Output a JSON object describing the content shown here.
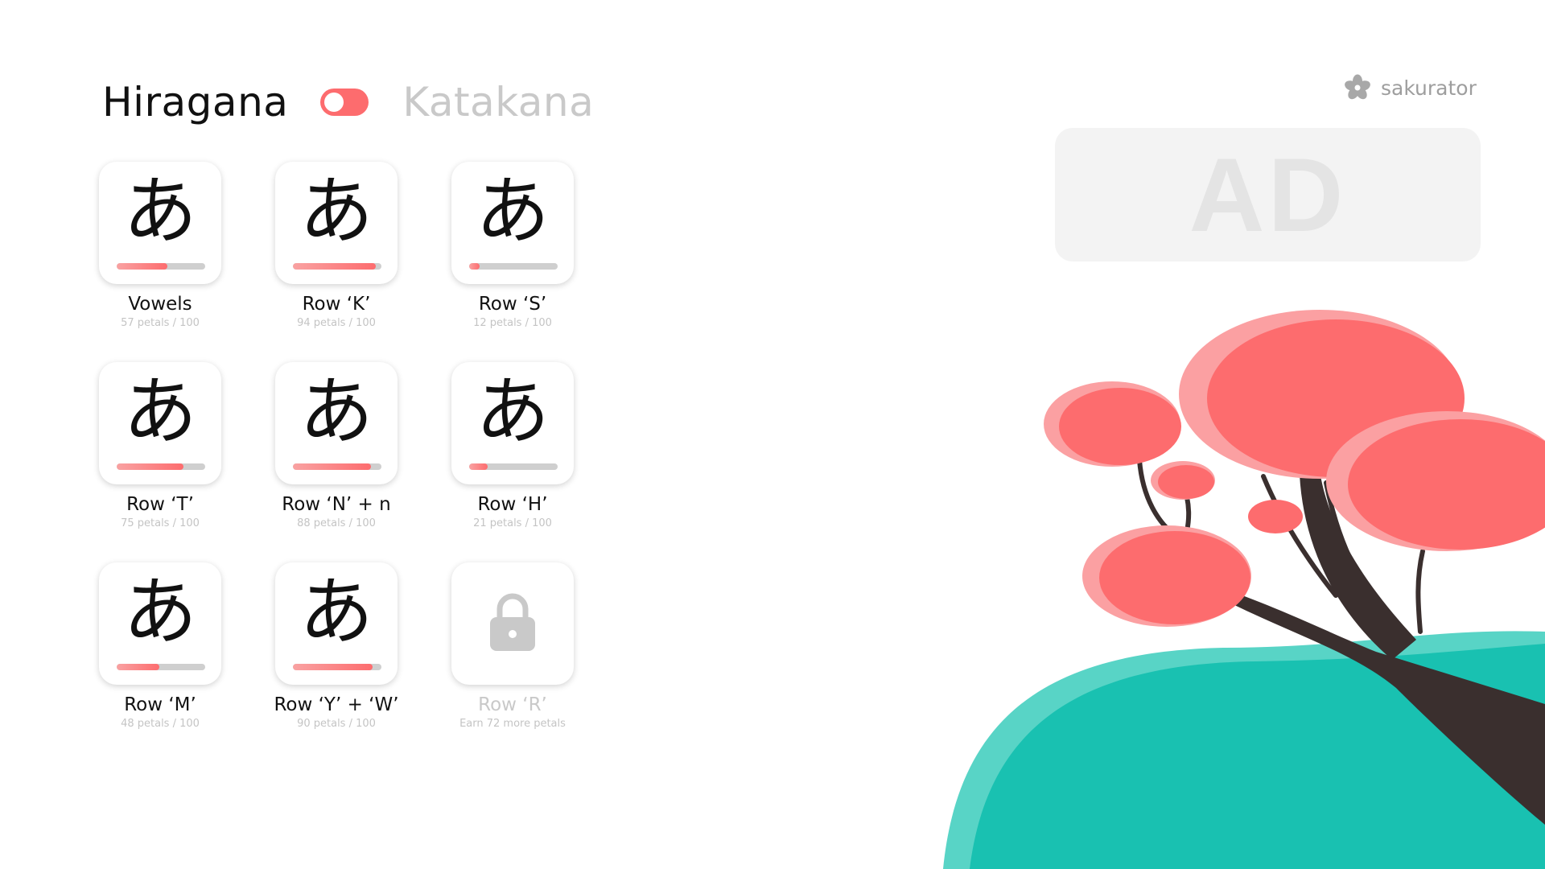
{
  "header": {
    "active_script": "Hiragana",
    "inactive_script": "Katakana"
  },
  "brand": {
    "name": "sakurator",
    "icon": "sakura-flower-icon"
  },
  "ad": {
    "text": "AD"
  },
  "colors": {
    "accent": "#fd6c6e",
    "accent_light": "#f9a2a2",
    "track": "#cfcfcf",
    "hill": "#19c1b1",
    "hill_light": "#58d4c6",
    "trunk": "#3a2f2e"
  },
  "tiles": [
    {
      "glyph": "あ",
      "label": "Vowels",
      "sub": "57 petals / 100",
      "progress": 0.57,
      "locked": false
    },
    {
      "glyph": "あ",
      "label": "Row ‘K’",
      "sub": "94 petals / 100",
      "progress": 0.94,
      "locked": false
    },
    {
      "glyph": "あ",
      "label": "Row ‘S’",
      "sub": "12 petals / 100",
      "progress": 0.12,
      "locked": false
    },
    {
      "glyph": "あ",
      "label": "Row ‘T’",
      "sub": "75 petals / 100",
      "progress": 0.75,
      "locked": false
    },
    {
      "glyph": "あ",
      "label": "Row ‘N’ + n",
      "sub": "88 petals / 100",
      "progress": 0.88,
      "locked": false
    },
    {
      "glyph": "あ",
      "label": "Row ‘H’",
      "sub": "21 petals / 100",
      "progress": 0.21,
      "locked": false
    },
    {
      "glyph": "あ",
      "label": "Row ‘M’",
      "sub": "48 petals / 100",
      "progress": 0.48,
      "locked": false
    },
    {
      "glyph": "あ",
      "label": "Row ‘Y’ + ‘W’",
      "sub": "90 petals / 100",
      "progress": 0.9,
      "locked": false
    },
    {
      "glyph": "",
      "label": "Row ‘R’",
      "sub": "Earn 72 more petals",
      "progress": 0,
      "locked": true,
      "icon": "lock-icon"
    }
  ]
}
